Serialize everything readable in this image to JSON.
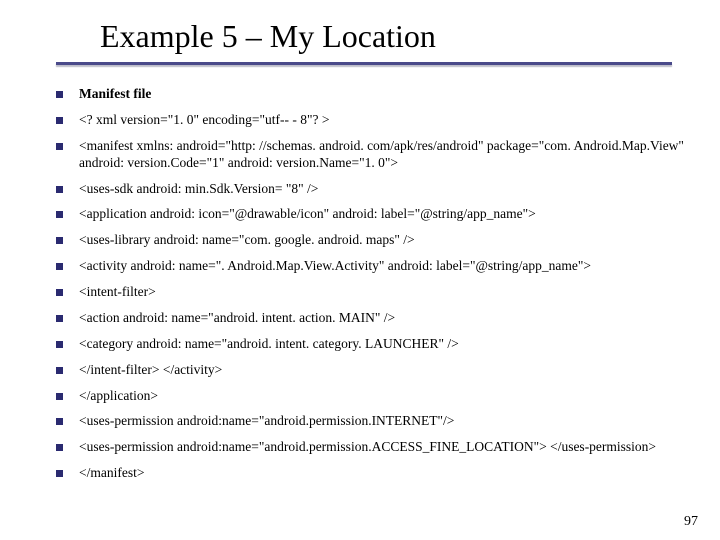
{
  "title": "Example 5 – My Location",
  "page_number": "97",
  "lines": [
    {
      "text": "Manifest file",
      "bold": true
    },
    {
      "text": "<? xml version=\"1. 0\" encoding=\"utf-- - 8\"? >"
    },
    {
      "text": "<manifest  xmlns: android=\"http: //schemas. android. com/apk/res/android\" package=\"com. Android.Map.View\" android: version.Code=\"1\" android: version.Name=\"1. 0\">"
    },
    {
      "text": "<uses‐sdk  android: min.Sdk.Version= \"8\" />"
    },
    {
      "text": "<application android: icon=\"@drawable/icon\"  android: label=\"@string/app_name\">"
    },
    {
      "text": "<uses‐library android: name=\"com. google. android. maps\" />"
    },
    {
      "text": "<activity android: name=\". Android.Map.View.Activity\" android: label=\"@string/app_name\">"
    },
    {
      "text": "<intent‐filter>"
    },
    {
      "text": "<action android: name=\"android. intent. action. MAIN\" />"
    },
    {
      "text": "<category android: name=\"android. intent. category. LAUNCHER\" />"
    },
    {
      "text": "</intent‐filter> </activity>"
    },
    {
      "text": "</application>"
    },
    {
      "text": "<uses‐permission android:name=\"android.permission.INTERNET\"/>"
    },
    {
      "text": "<uses‐permission  android:name=\"android.permission.ACCESS_FINE_LOCATION\"> </uses‐permission>"
    },
    {
      "text": "</manifest>"
    }
  ]
}
